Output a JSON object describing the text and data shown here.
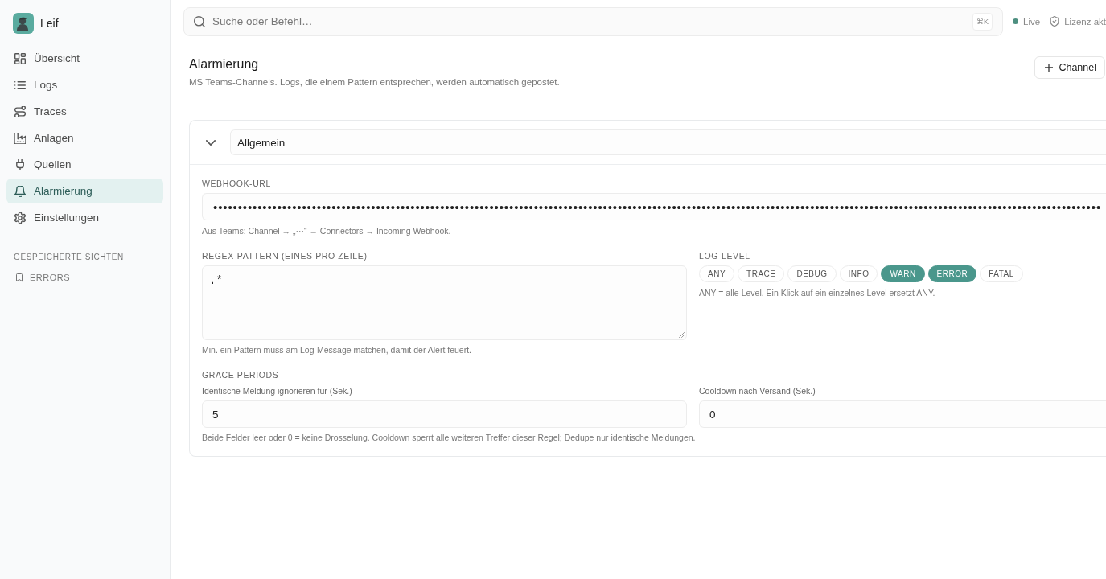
{
  "sidebar": {
    "brand": {
      "name": "Leif"
    },
    "nav_items": [
      {
        "label": "Übersicht",
        "selected": false
      },
      {
        "label": "Logs",
        "selected": false
      },
      {
        "label": "Traces",
        "selected": false
      },
      {
        "label": "Anlagen",
        "selected": false
      },
      {
        "label": "Quellen",
        "selected": false
      },
      {
        "label": "Alarmierung",
        "selected": true
      },
      {
        "label": "Einstellungen",
        "selected": false
      }
    ],
    "saved_views": {
      "heading": "GESPEICHERTE SICHTEN",
      "items": [
        {
          "label": "ERRORS"
        }
      ]
    }
  },
  "topbar": {
    "search": {
      "placeholder": "Suche oder Befehl…",
      "shortcut": "⌘K"
    },
    "status": "Live",
    "license": "Lizenz akt"
  },
  "page_header": {
    "title": "Alarmierung",
    "subtitle": "MS Teams-Channels. Logs, die einem Pattern entsprechen, werden automatisch gepostet.",
    "add_button": "Channel"
  },
  "channel_card": {
    "expanded": true,
    "name": "Allgemein",
    "webhook": {
      "label": "WEBHOOK-URL",
      "value": "••••••••••••••••••••••••••••••••••••••••••••••••••••••••••••••••••••••••••••••••••••••••••••••••••••••••••••••••••••••••••••••••••••••••••••••••••••••••••••••••••••••••••••••••••••",
      "hint": "Aus Teams: Channel → „···“ → Connectors → Incoming Webhook."
    },
    "patterns": {
      "label": "REGEX-PATTERN (EINES PRO ZEILE)",
      "value": ".*",
      "hint": "Min. ein Pattern muss am Log-Message matchen, damit der Alert feuert."
    },
    "log_level": {
      "label": "LOG-LEVEL",
      "levels": [
        {
          "label": "ANY",
          "selected": false
        },
        {
          "label": "TRACE",
          "selected": false
        },
        {
          "label": "DEBUG",
          "selected": false
        },
        {
          "label": "INFO",
          "selected": false
        },
        {
          "label": "WARN",
          "selected": true
        },
        {
          "label": "ERROR",
          "selected": true
        },
        {
          "label": "FATAL",
          "selected": false
        }
      ],
      "hint": "ANY = alle Level. Ein Klick auf ein einzelnes Level ersetzt ANY."
    },
    "grace_periods": {
      "label": "GRACE PERIODS",
      "fields": [
        {
          "label": "Identische Meldung ignorieren für (Sek.)",
          "value": "5"
        },
        {
          "label": "Cooldown nach Versand (Sek.)",
          "value": "0"
        }
      ],
      "hint": "Beide Felder leer oder 0 = keine Drosselung. Cooldown sperrt alle weiteren Treffer dieser Regel; Dedupe nur identische Meldungen."
    }
  }
}
